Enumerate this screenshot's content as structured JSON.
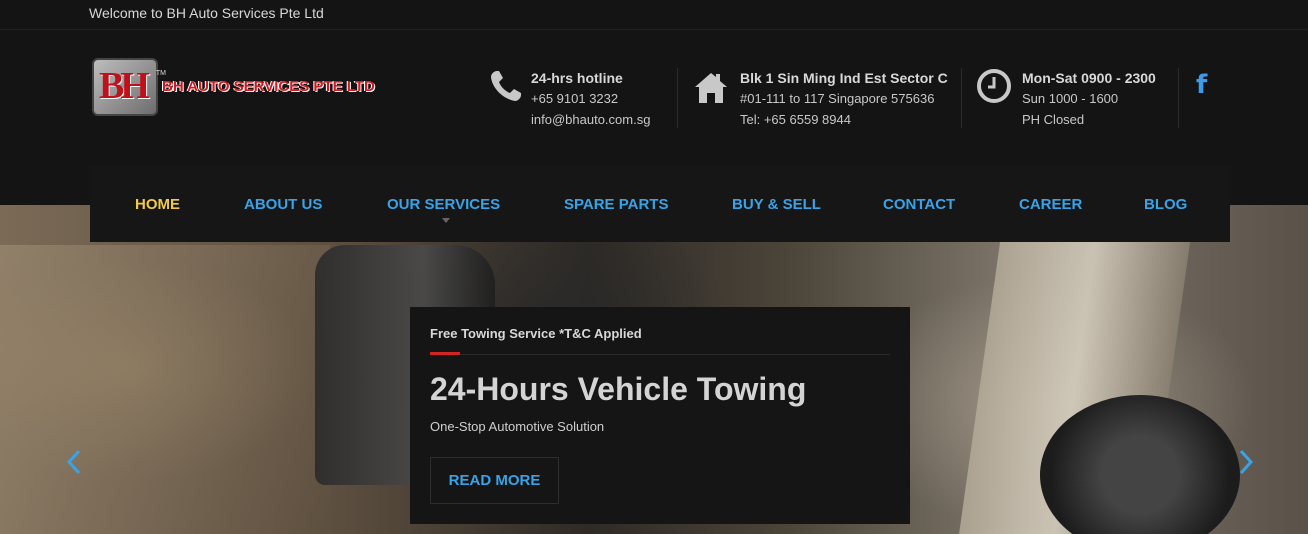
{
  "topbar": {
    "welcome": "Welcome to BH Auto Services Pte Ltd"
  },
  "logo": {
    "mark": "BH",
    "tm": "TM",
    "text": "BH AUTO SERVICES PTE LTD"
  },
  "contact": {
    "hotline": {
      "icon": "phone-icon",
      "title": "24-hrs hotline",
      "line1": "+65 9101 3232",
      "line2": "info@bhauto.com.sg"
    },
    "address": {
      "icon": "home-icon",
      "title": "Blk 1 Sin Ming Ind Est Sector C",
      "line1": "#01-111 to 117 Singapore 575636",
      "line2": "Tel: +65 6559 8944"
    },
    "hours": {
      "icon": "clock-icon",
      "title": "Mon-Sat 0900 - 2300",
      "line1": "Sun 1000 - 1600",
      "line2": "PH Closed"
    },
    "social": {
      "icon": "facebook-icon",
      "glyph": "f"
    }
  },
  "nav": {
    "items": [
      {
        "label": "HOME",
        "active": true
      },
      {
        "label": "ABOUT US"
      },
      {
        "label": "OUR SERVICES",
        "has_dropdown": true
      },
      {
        "label": "SPARE PARTS"
      },
      {
        "label": "BUY & SELL"
      },
      {
        "label": "CONTACT"
      },
      {
        "label": "CAREER"
      },
      {
        "label": "BLOG"
      }
    ]
  },
  "slide": {
    "subtitle": "Free Towing Service *T&C Applied",
    "title": "24-Hours Vehicle Towing",
    "description": "One-Stop Automotive Solution",
    "button": "READ MORE"
  },
  "colors": {
    "accent": "#39a3e8",
    "active": "#f2c94c",
    "brand_red": "#d01a22",
    "background": "#141414"
  }
}
